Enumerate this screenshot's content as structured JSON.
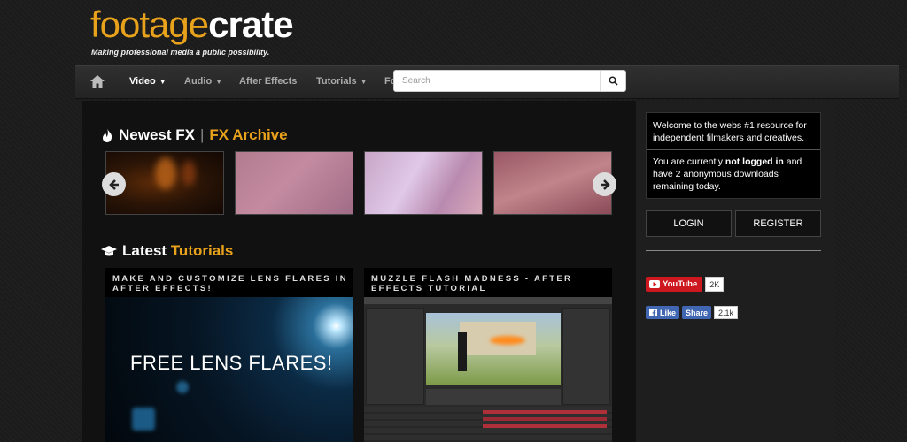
{
  "header": {
    "logo_part1": "footage",
    "logo_part2": "crate",
    "tagline": "Making professional media a public possibility."
  },
  "nav": {
    "home_icon": "home-icon",
    "items": [
      {
        "label": "Video",
        "active": true,
        "dropdown": true
      },
      {
        "label": "Audio",
        "dropdown": true
      },
      {
        "label": "After Effects",
        "dropdown": false
      },
      {
        "label": "Tutorials",
        "dropdown": true
      },
      {
        "label": "Fo",
        "dropdown": false
      }
    ],
    "search_placeholder": "Search",
    "search_icon": "search-icon"
  },
  "newest": {
    "title": "Newest FX",
    "separator": "|",
    "archive_link": "FX Archive"
  },
  "latest": {
    "title_prefix": "Latest",
    "title_accent": "Tutorials"
  },
  "tutorials": [
    {
      "title": "Make and customize lens flares in after effects!",
      "image_text": "FREE LENS FLARES!"
    },
    {
      "title": "Muzzle Flash Madness - After Effects Tutorial"
    }
  ],
  "sidebar": {
    "welcome": "Welcome to the webs #1 resource for independent filmakers and creatives.",
    "status_prefix": "You are currently ",
    "status_bold": "not logged in",
    "status_suffix": " and have 2 anonymous downloads remaining today.",
    "login_label": "LOGIN",
    "register_label": "REGISTER",
    "youtube_label": "YouTube",
    "youtube_count": "2K",
    "fb_like": "Like",
    "fb_share": "Share",
    "fb_count": "2.1k"
  },
  "colors": {
    "accent": "#e8a21c",
    "youtube": "#cc181e",
    "facebook": "#4267b2"
  }
}
